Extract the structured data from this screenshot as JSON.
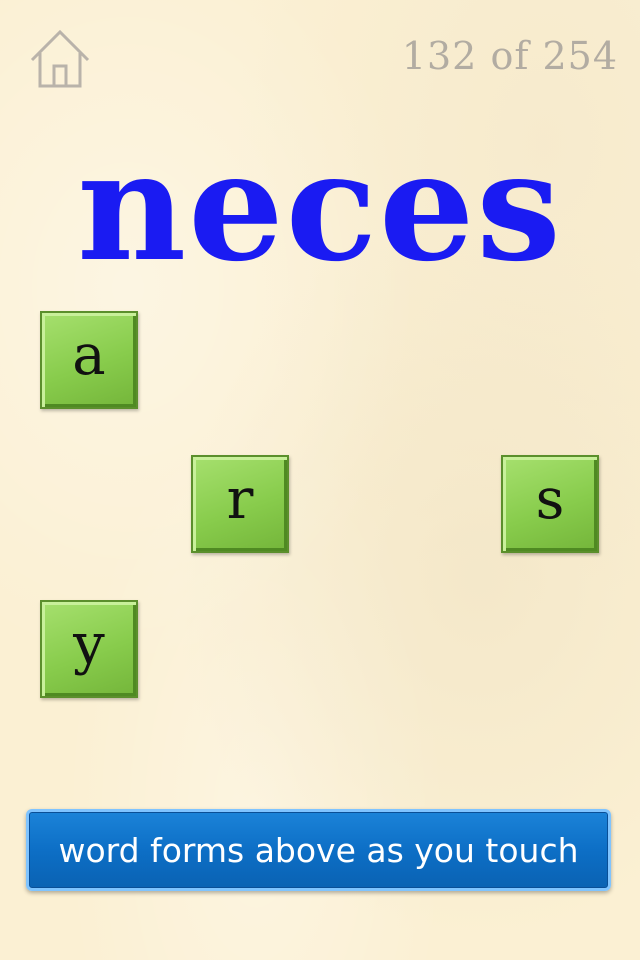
{
  "header": {
    "home_icon": "home-icon",
    "progress_text": "132 of 254"
  },
  "puzzle": {
    "partial_word": "neces",
    "letter_tiles": [
      {
        "letter": "a"
      },
      {
        "letter": "r"
      },
      {
        "letter": "s"
      },
      {
        "letter": "y"
      }
    ]
  },
  "hint": {
    "text": "word forms above as you touch"
  },
  "colors": {
    "word": "#1a1bf2",
    "tile": "#88cc4c",
    "hint_bar": "#0d6fc6",
    "background": "#fbf0d3"
  }
}
